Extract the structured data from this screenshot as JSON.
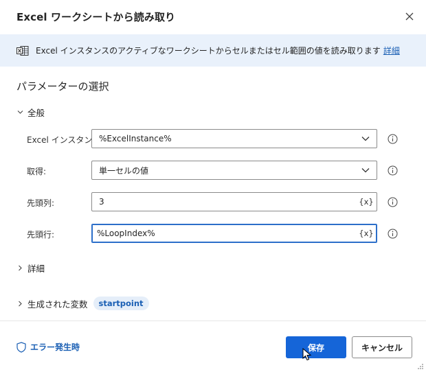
{
  "dialog": {
    "title": "Excel ワークシートから読み取り"
  },
  "banner": {
    "description": "Excel インスタンスのアクティブなワークシートからセルまたはセル範囲の値を読み取ります",
    "more_link": "詳細"
  },
  "parameters": {
    "section_title": "パラメーターの選択",
    "general_group": "全般",
    "fields": {
      "excel_instance": {
        "label": "Excel インスタンス:",
        "value": "%ExcelInstance%"
      },
      "retrieve": {
        "label": "取得:",
        "value": "単一セルの値"
      },
      "start_column": {
        "label": "先頭列:",
        "value": "3",
        "var_button": "{x}"
      },
      "start_row": {
        "label": "先頭行:",
        "value": "%LoopIndex%",
        "var_button": "{x}"
      }
    },
    "advanced_group": "詳細",
    "variables_group": "生成された変数",
    "variable_badge": "startpoint"
  },
  "footer": {
    "on_error": "エラー発生時",
    "save": "保存",
    "cancel": "キャンセル"
  },
  "colors": {
    "accent": "#1565d8",
    "link": "#1a5fb4",
    "banner_bg": "#e9f1fb"
  }
}
